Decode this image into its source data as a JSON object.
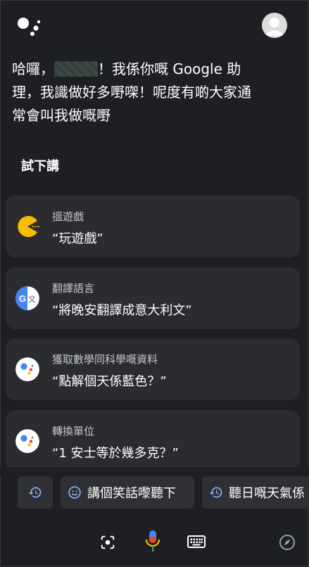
{
  "greeting": {
    "line1_prefix": "哈囉，",
    "line1_suffix": "！我係你嘅 Google 助",
    "line2": "理，我識做好多嘢㗎！呢度有啲大家通",
    "line3": "常會叫我做嘅嘢"
  },
  "section_title": "試下講",
  "cards": [
    {
      "category": "搵遊戲",
      "example": "“玩遊戲”",
      "icon": "pacman-icon"
    },
    {
      "category": "翻譯語言",
      "example": "“將晚安翻譯成意大利文”",
      "icon": "google-translate-icon"
    },
    {
      "category": "獲取數學同科學嘅資料",
      "example": "“點解個天係藍色？”",
      "icon": "google-assistant-icon"
    },
    {
      "category": "轉換單位",
      "example": "“1 安士等於幾多克？”",
      "icon": "google-assistant-icon"
    }
  ],
  "chips": [
    {
      "label": "",
      "icon": "history-icon"
    },
    {
      "label": "講個笑話嚟聽下",
      "icon": "smiley-icon"
    },
    {
      "label": "聽日嘅天氣係",
      "icon": "history-icon"
    }
  ],
  "translate_icon_letters": {
    "g": "G",
    "zh": "文"
  },
  "bottom_bar": [
    "lens-icon",
    "microphone-icon",
    "keyboard-icon",
    "compass-icon"
  ],
  "colors": {
    "background": "#1e1f22",
    "card": "#2b2c30",
    "google_blue": "#4285f4",
    "google_red": "#ea4335",
    "google_yellow": "#fbbc04",
    "google_green": "#34a853",
    "chip_icon": "#8ab4f8"
  }
}
